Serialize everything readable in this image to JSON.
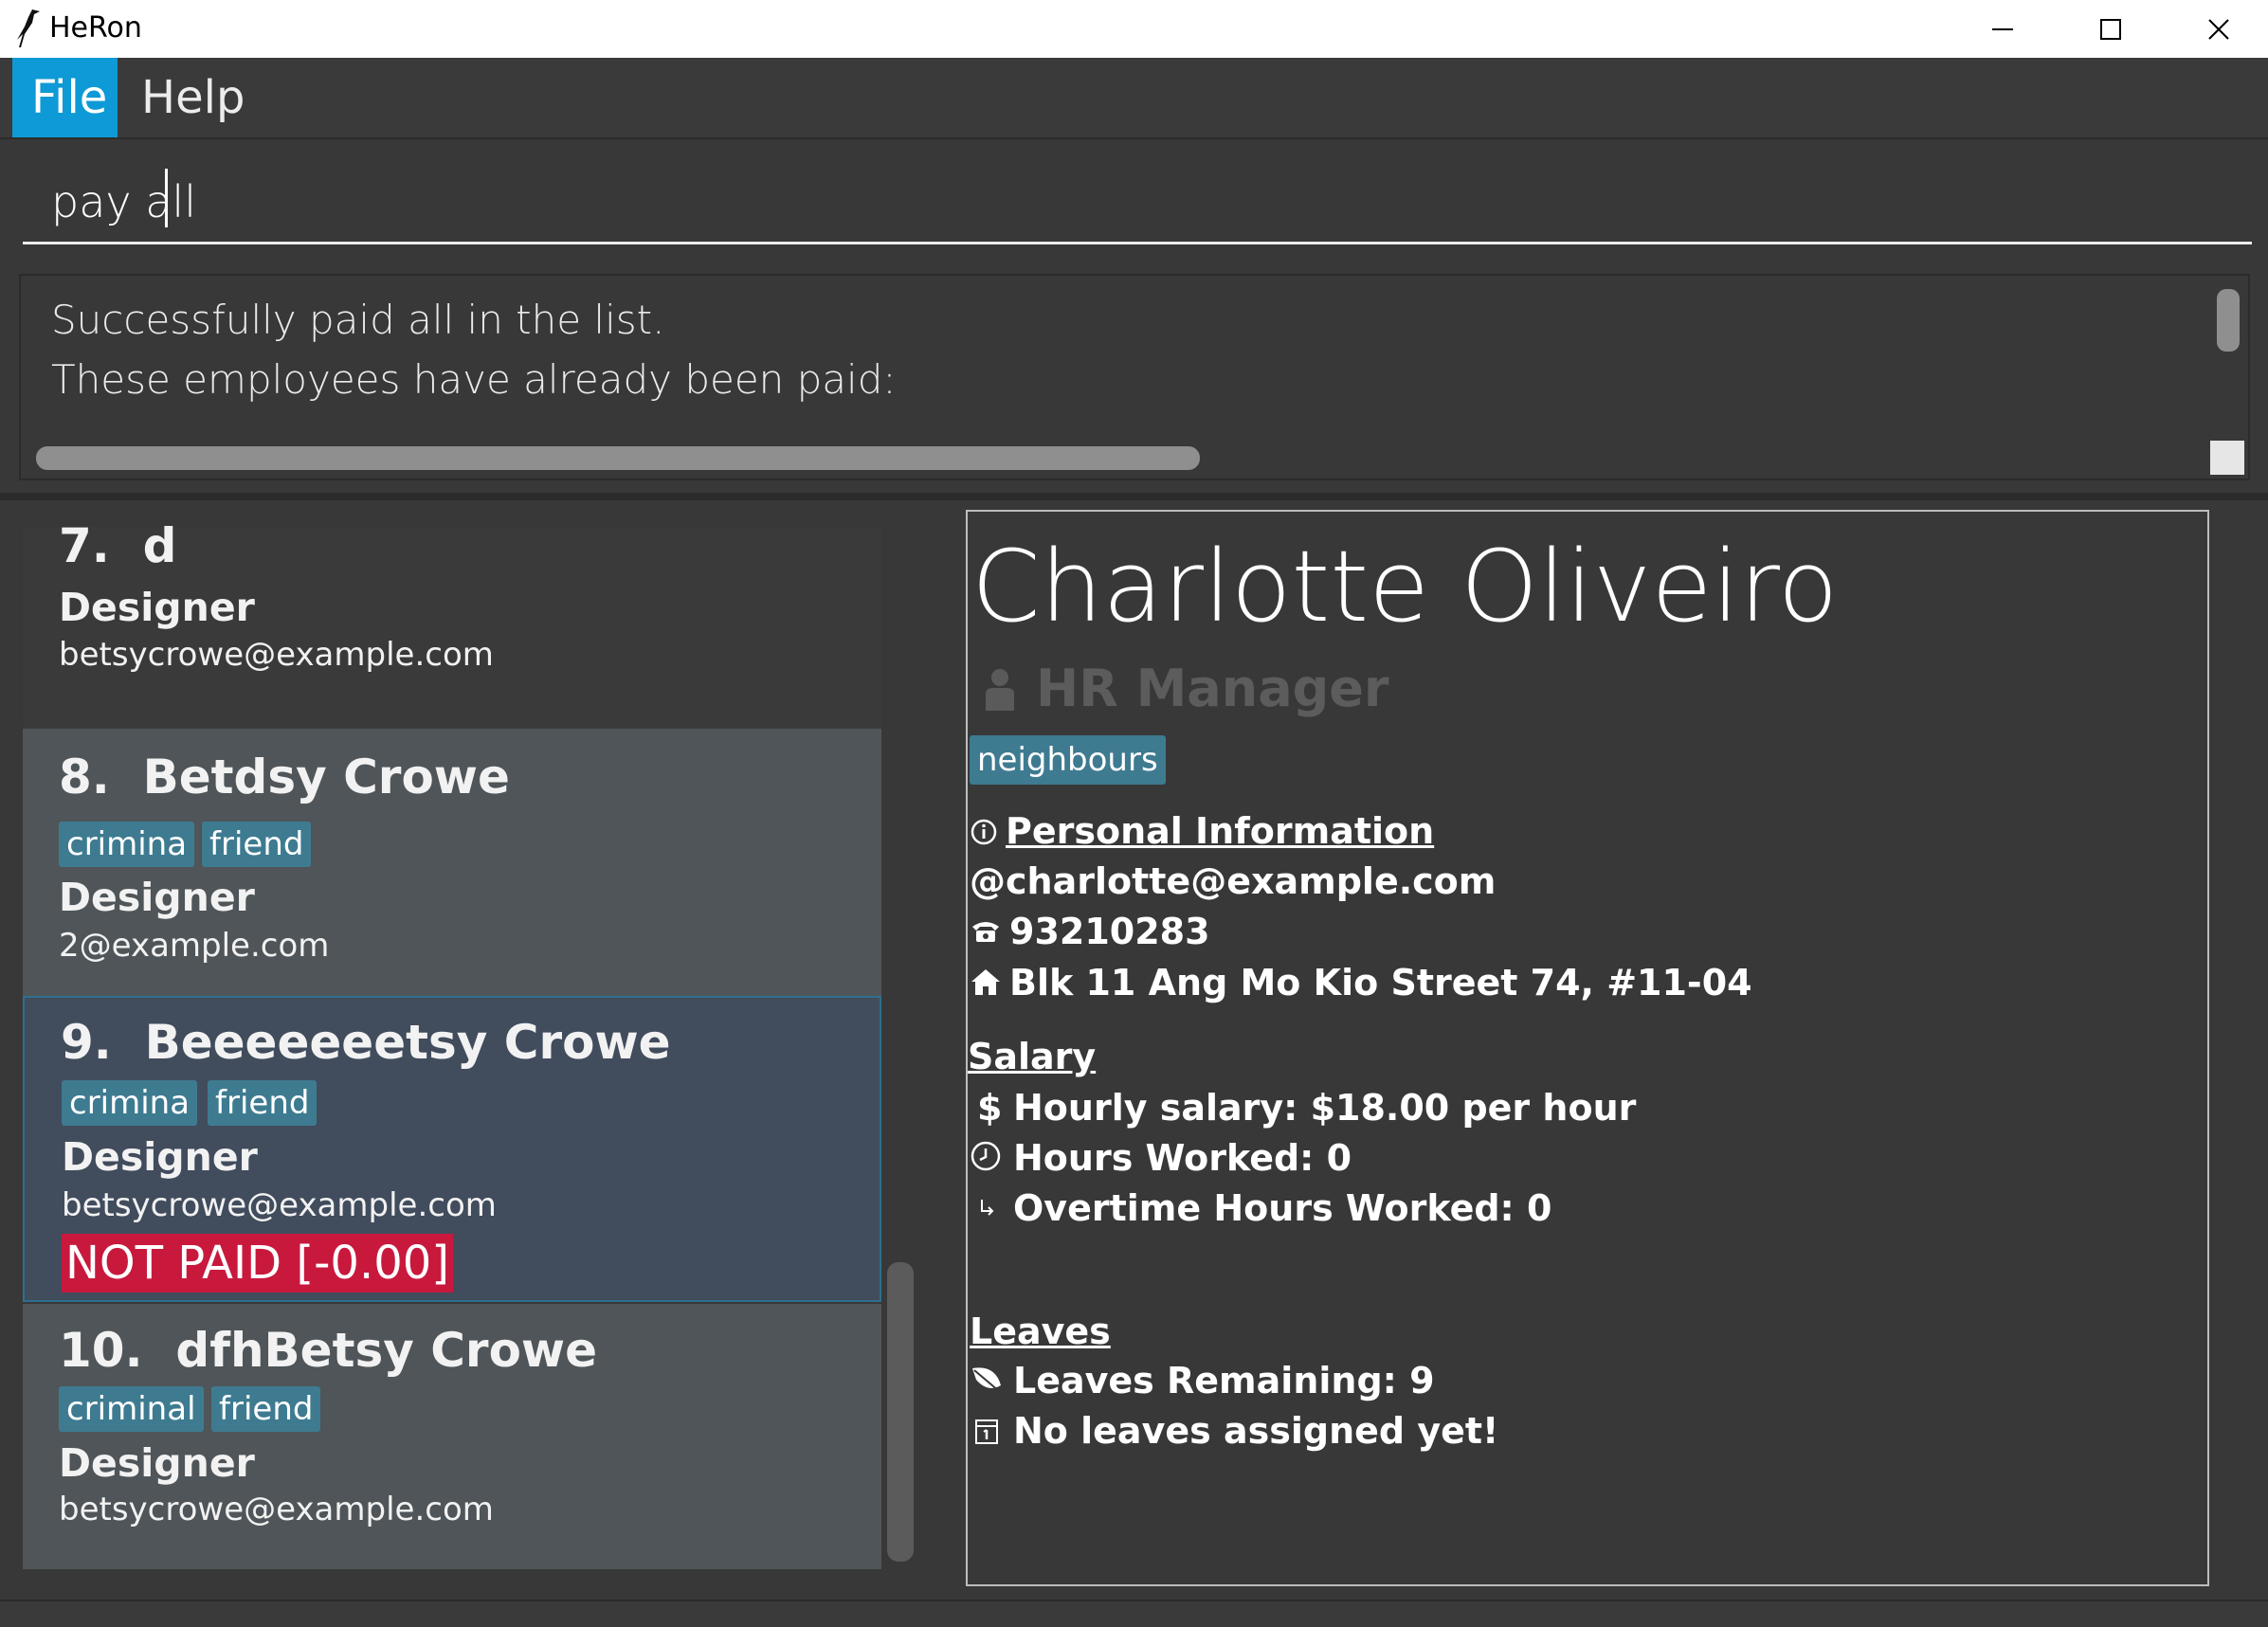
{
  "window": {
    "title": "HeRon"
  },
  "menu": {
    "file": "File",
    "help": "Help"
  },
  "command": {
    "value": "pay all"
  },
  "result": {
    "line1": "Successfully paid all in the list.",
    "line2": "These employees have already been paid:"
  },
  "list": {
    "cards": [
      {
        "index": "7.",
        "name": "d",
        "role": "Designer",
        "email": "betsycrowe@example.com",
        "tags": []
      },
      {
        "index": "8.",
        "name": "Betdsy Crowe",
        "role": "Designer",
        "email": "2@example.com",
        "tags": [
          "crimina",
          "friend"
        ]
      },
      {
        "index": "9.",
        "name": "Beeeeeeetsy Crowe",
        "role": "Designer",
        "email": "betsycrowe@example.com",
        "tags": [
          "crimina",
          "friend"
        ],
        "status": "NOT PAID [-0.00]"
      },
      {
        "index": "10.",
        "name": "dfhBetsy Crowe",
        "role": "Designer",
        "email": "betsycrowe@example.com",
        "tags": [
          "criminal",
          "friend"
        ]
      }
    ]
  },
  "detail": {
    "name": "Charlotte Oliveiro",
    "role": "HR Manager",
    "tag": "neighbours",
    "personal": {
      "heading": "Personal Information",
      "email": "charlotte@example.com",
      "phone": "93210283",
      "address": "Blk 11 Ang Mo Kio Street 74, #11-04"
    },
    "salary": {
      "heading": "Salary",
      "hourly": "Hourly salary: $18.00 per hour",
      "hours": "Hours Worked: 0",
      "overtime": "Overtime Hours Worked: 0"
    },
    "leaves": {
      "heading": "Leaves",
      "remaining": "Leaves Remaining: 9",
      "assigned": "No leaves assigned yet!"
    }
  },
  "colors": {
    "menu_accent": "#0e9ad6",
    "tag": "#3e7b91",
    "not_paid": "#c8193d",
    "selected_card": "#414c5d",
    "card_alt": "#4f5558"
  },
  "icons": {
    "info": "info-icon",
    "email": "at-icon",
    "phone": "phone-icon",
    "address": "home-icon",
    "salary": "dollar-icon",
    "hours": "clock-icon",
    "overtime": "arrow-icon",
    "leaves": "leaf-icon",
    "calendar": "calendar-icon",
    "role": "person-icon"
  }
}
